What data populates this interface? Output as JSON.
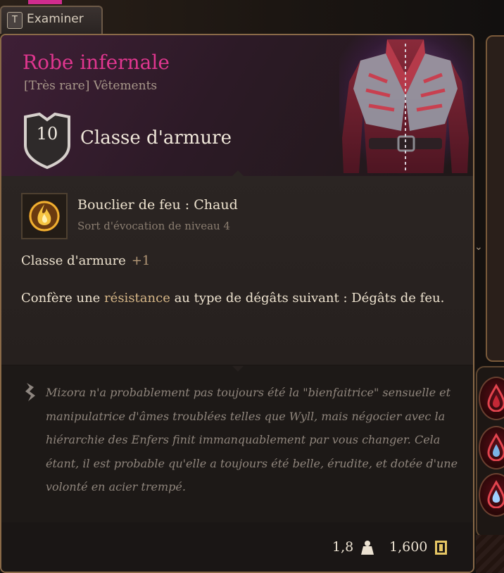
{
  "examine_tab": {
    "key": "T",
    "label": "Examiner"
  },
  "item": {
    "name": "Robe infernale",
    "subtitle": "[Très rare] Vêtements",
    "armor_class_value": "10",
    "armor_class_label": "Classe d'armure",
    "name_color": "#e0368f"
  },
  "spell": {
    "icon": "fire-shield-icon",
    "name": "Bouclier de feu : Chaud",
    "subtitle": "Sort d'évocation de niveau 4"
  },
  "bonus": {
    "label": "Classe d'armure",
    "value": "+1"
  },
  "description": {
    "before": "Confère une ",
    "keyword": "résistance",
    "after": " au type de dégâts suivant : Dégâts de feu."
  },
  "lore": "Mizora n'a probablement pas toujours été la \"bienfaitrice\" sensuelle et manipulatrice d'âmes troublées telles que Wyll, mais négocier avec la hiérarchie des Enfers finit immanquablement par vous changer. Cela étant, il est probable qu'elle a toujours été belle, érudite, et dotée d'une volonté en acier trempé.",
  "footer": {
    "weight": "1,8",
    "weight_icon": "weight-icon",
    "value": "1,600",
    "value_icon": "gold-coin-icon"
  }
}
